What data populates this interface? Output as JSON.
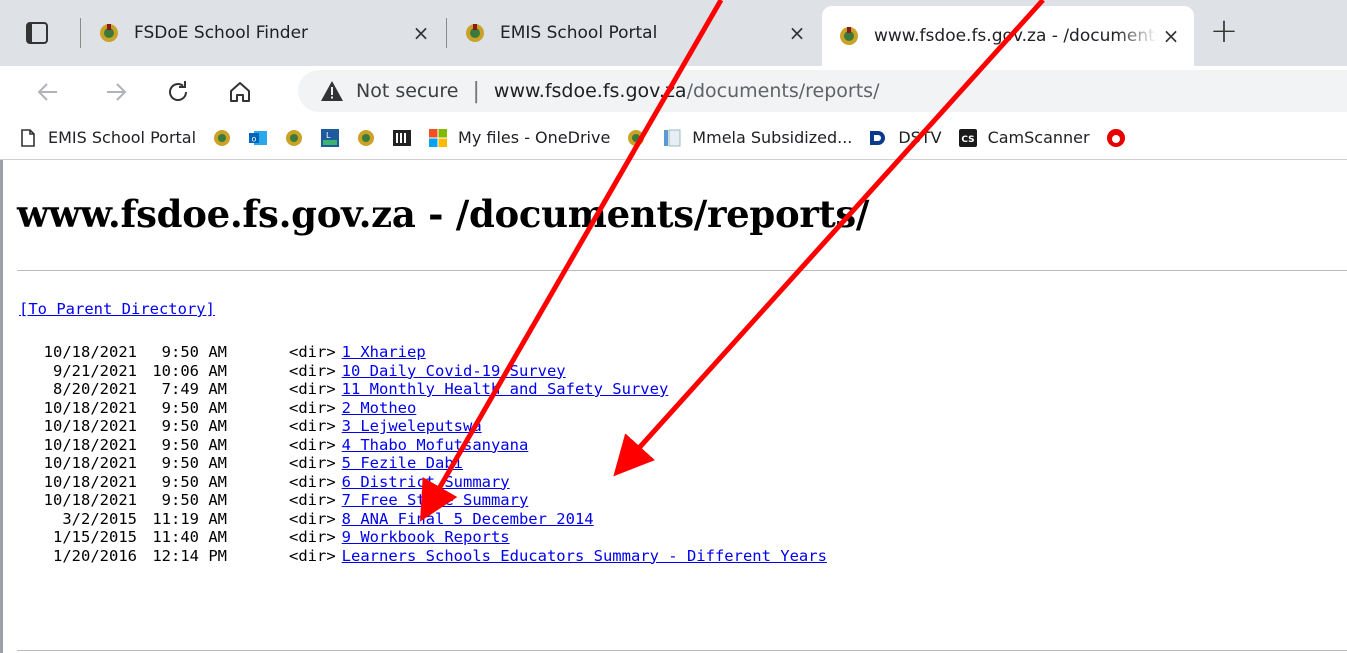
{
  "tabs": [
    {
      "title": "FSDoE School Finder",
      "close": "×"
    },
    {
      "title": "EMIS School Portal",
      "close": "×"
    },
    {
      "title": "www.fsdoe.fs.gov.za - /documents/reports/",
      "close": "×"
    }
  ],
  "new_tab": "+",
  "address": {
    "security_label": "Not secure",
    "separator": "|",
    "host": "www.fsdoe.fs.gov.za",
    "path": "/documents/reports/"
  },
  "bookmarks": [
    {
      "label": "EMIS School Portal",
      "icon": "page-icon"
    },
    {
      "label": "",
      "icon": "crest-icon"
    },
    {
      "label": "",
      "icon": "outlook-icon"
    },
    {
      "label": "",
      "icon": "crest-icon"
    },
    {
      "label": "",
      "icon": "live-icon"
    },
    {
      "label": "",
      "icon": "crest-icon"
    },
    {
      "label": "",
      "icon": "faith-icon"
    },
    {
      "label": "My files - OneDrive",
      "icon": "microsoft-icon"
    },
    {
      "label": "",
      "icon": "crest-icon"
    },
    {
      "label": "Mmela Subsidized...",
      "icon": "doc-icon"
    },
    {
      "label": "DSTV",
      "icon": "dstv-icon"
    },
    {
      "label": "CamScanner",
      "icon": "camscanner-icon"
    },
    {
      "label": "",
      "icon": "vodafone-icon"
    }
  ],
  "page": {
    "heading": "www.fsdoe.fs.gov.za - /documents/reports/",
    "parent_link": "[To Parent Directory]",
    "entries": [
      {
        "date": "10/18/2021",
        "time": "9:50 AM",
        "type": "<dir>",
        "name": "1 Xhariep"
      },
      {
        "date": "9/21/2021",
        "time": "10:06 AM",
        "type": "<dir>",
        "name": "10 Daily Covid-19 Survey"
      },
      {
        "date": "8/20/2021",
        "time": "7:49 AM",
        "type": "<dir>",
        "name": "11 Monthly Health and Safety Survey"
      },
      {
        "date": "10/18/2021",
        "time": "9:50 AM",
        "type": "<dir>",
        "name": "2 Motheo"
      },
      {
        "date": "10/18/2021",
        "time": "9:50 AM",
        "type": "<dir>",
        "name": "3 Lejweleputswa"
      },
      {
        "date": "10/18/2021",
        "time": "9:50 AM",
        "type": "<dir>",
        "name": "4 Thabo Mofutsanyana"
      },
      {
        "date": "10/18/2021",
        "time": "9:50 AM",
        "type": "<dir>",
        "name": "5 Fezile Dabi"
      },
      {
        "date": "10/18/2021",
        "time": "9:50 AM",
        "type": "<dir>",
        "name": "6 District Summary"
      },
      {
        "date": "10/18/2021",
        "time": "9:50 AM",
        "type": "<dir>",
        "name": "7 Free State Summary"
      },
      {
        "date": "3/2/2015",
        "time": "11:19 AM",
        "type": "<dir>",
        "name": "8 ANA Final 5 December 2014"
      },
      {
        "date": "1/15/2015",
        "time": "11:40 AM",
        "type": "<dir>",
        "name": "9 Workbook Reports"
      },
      {
        "date": "1/20/2016",
        "time": "12:14 PM",
        "type": "<dir>",
        "name": "Learners Schools Educators Summary - Different Years"
      }
    ]
  },
  "colors": {
    "link": "#0000ee",
    "annotation_arrow": "#ff0000",
    "tabbar": "#dee1e6"
  }
}
